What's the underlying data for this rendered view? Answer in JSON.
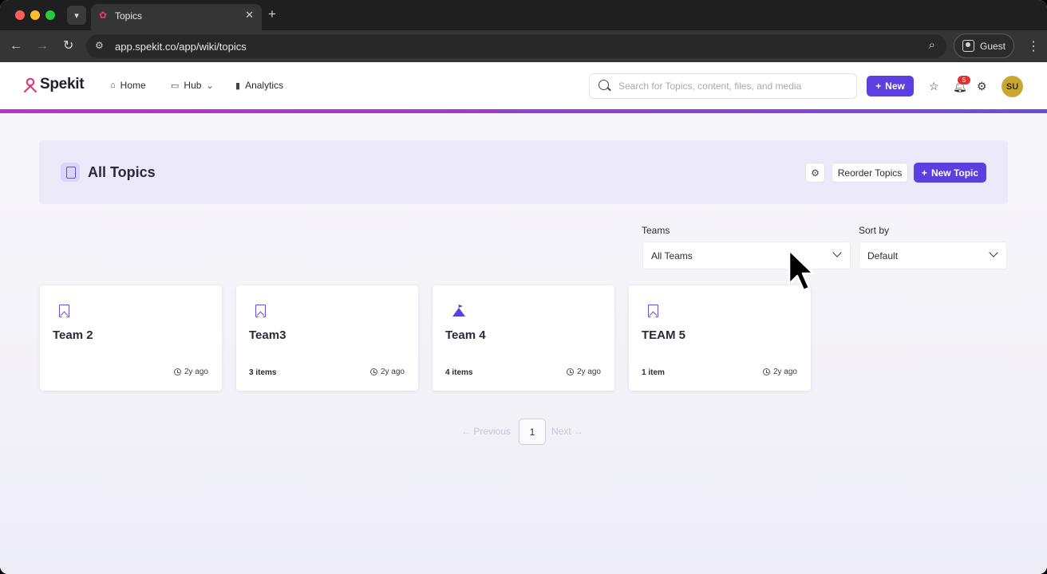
{
  "browser": {
    "tab_title": "Topics",
    "url": "app.spekit.co/app/wiki/topics",
    "profile_label": "Guest",
    "new_tab_symbol": "+",
    "tab_close_symbol": "✕"
  },
  "header": {
    "logo_text": "Spekit",
    "nav": [
      {
        "label": "Home",
        "icon": "home-icon"
      },
      {
        "label": "Hub",
        "icon": "folder-icon"
      },
      {
        "label": "Analytics",
        "icon": "bar-chart-icon"
      }
    ],
    "search_placeholder": "Search for Topics, content, files, and media",
    "new_button_label": "New",
    "notification_count": "5",
    "avatar_initials": "SU"
  },
  "banner": {
    "title": "All Topics",
    "reorder_label": "Reorder Topics",
    "new_topic_label": "New Topic"
  },
  "filters": {
    "teams_label": "Teams",
    "teams_value": "All Teams",
    "sort_label": "Sort by",
    "sort_value": "Default"
  },
  "cards": [
    {
      "title": "Team 2",
      "count": "",
      "time": "2y ago",
      "icon": "bookmark-icon"
    },
    {
      "title": "Team3",
      "count": "3 items",
      "time": "2y ago",
      "icon": "bookmark-icon"
    },
    {
      "title": "Team 4",
      "count": "4 items",
      "time": "2y ago",
      "icon": "mountain-flag-icon"
    },
    {
      "title": "TEAM 5",
      "count": "1 item",
      "time": "2y ago",
      "icon": "bookmark-icon"
    }
  ],
  "pagination": {
    "prev_label": "Previous",
    "current_page": "1",
    "next_label": "Next"
  },
  "colors": {
    "primary": "#5b3fe0",
    "accent_gradient_start": "#c12ec8",
    "accent_gradient_end": "#6d4be0",
    "banner_bg": "#ece9fb",
    "badge": "#e03131",
    "avatar_bg": "#c9a832"
  }
}
